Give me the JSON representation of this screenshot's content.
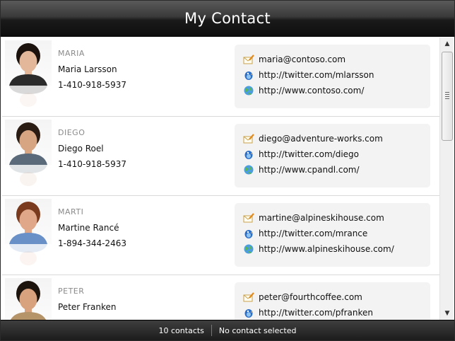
{
  "window": {
    "title": "My Contact"
  },
  "contacts": [
    {
      "short": "MARIA",
      "name": "Maria Larsson",
      "phone": "1-410-918-5937",
      "email": "maria@contoso.com",
      "twitter": "http://twitter.com/mlarsson",
      "web": "http://www.contoso.com/",
      "skin": "#e2b79a",
      "hair": "#1b120d",
      "shirt": "#2b2b2b"
    },
    {
      "short": "DIEGO",
      "name": "Diego Roel",
      "phone": "1-410-918-5937",
      "email": "diego@adventure-works.com",
      "twitter": "http://twitter.com/diego",
      "web": "http://www.cpandl.com/",
      "skin": "#d8a583",
      "hair": "#2a1c12",
      "shirt": "#5a6a7a"
    },
    {
      "short": "MARTI",
      "name": "Martine Rancé",
      "phone": "1-894-344-2463",
      "email": "martine@alpineskihouse.com",
      "twitter": "http://twitter.com/mrance",
      "web": "http://www.alpineskihouse.com/",
      "skin": "#e0a888",
      "hair": "#7a3a1e",
      "shirt": "#6a90c8"
    },
    {
      "short": "PETER",
      "name": "Peter Franken",
      "phone": "",
      "email": "peter@fourthcoffee.com",
      "twitter": "http://twitter.com/pfranken",
      "web": "",
      "skin": "#d9a27e",
      "hair": "#1e140e",
      "shirt": "#b5946a"
    }
  ],
  "status": {
    "count": "10 contacts",
    "selection": "No contact selected"
  },
  "icons": {
    "email": "envelope-pencil-icon",
    "twitter": "twitter-bird-icon",
    "web": "globe-icon"
  }
}
